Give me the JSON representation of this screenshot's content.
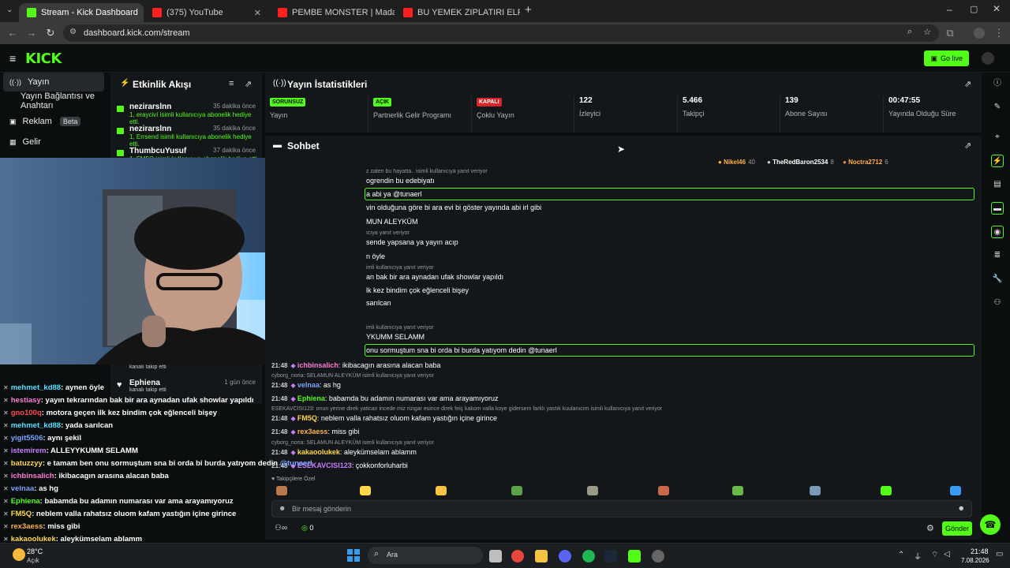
{
  "browser": {
    "tabs": [
      {
        "title": "Stream - Kick Dashboard",
        "fav": "#53fc18",
        "active": true
      },
      {
        "title": "(375) YouTube",
        "fav": "#ff2020",
        "active": false
      },
      {
        "title": "PEMBE MONSTER | Madara Ol",
        "fav": "#ff2020",
        "active": false
      },
      {
        "title": "BU YEMEK ZIPLATIRI ELRAEN, L",
        "fav": "#ff2020",
        "active": false
      }
    ],
    "url": "dashboard.kick.com/stream"
  },
  "header": {
    "logo": "KICK",
    "golive_label": "Go live"
  },
  "nav": {
    "items": [
      {
        "label": "Yayın",
        "icon": "broadcast-icon"
      },
      {
        "label": "Yayın Bağlantısı ve Anahtarı",
        "icon": ""
      },
      {
        "label": "Reklam",
        "icon": "ad-icon",
        "badge": "Beta"
      },
      {
        "label": "Gelir",
        "icon": "revenue-icon"
      }
    ]
  },
  "activity": {
    "title": "Etkinlik Akışı",
    "items": [
      {
        "name": "nezirarslnn",
        "time": "35 dakika önce",
        "detail": "1, erayciví isimli kullanıcıya abonelik hediye etti."
      },
      {
        "name": "nezirarslnn",
        "time": "35 dakika önce",
        "detail": "1, Errsend isimli kullanıcıya abonelik hediye etti."
      },
      {
        "name": "ThumbcuYusuf",
        "time": "37 dakika önce",
        "detail": "1, FM5Q isimli kullanıcıya abonelik hediye etti."
      }
    ],
    "lower": [
      {
        "detail": "kanalı takip etti"
      },
      {
        "name": "Ephiena",
        "time": "1 gün önce",
        "detail": "kanalı takip etti"
      }
    ]
  },
  "stats": {
    "title": "Yayın İstatistikleri",
    "cells": [
      {
        "badge": "SORUNSUZ",
        "label": "Yayın",
        "color": "#53fc18"
      },
      {
        "badge": "AÇIK",
        "label": "Partnerlik Gelir Programı",
        "color": "#53fc18"
      },
      {
        "badge": "KAPALI",
        "label": "Çoklu Yayın",
        "color": "#d8262c"
      },
      {
        "value": "122",
        "label": "İzleyici"
      },
      {
        "value": "5.466",
        "label": "Takipçi"
      },
      {
        "value": "139",
        "label": "Abone Sayısı"
      },
      {
        "value": "00:47:55",
        "label": "Yayında Olduğu Süre"
      }
    ]
  },
  "chat": {
    "title": "Sohbet",
    "top_users": [
      {
        "name": "Nikel46",
        "count": "40"
      },
      {
        "name": "TheRedBaron2534",
        "count": "8"
      },
      {
        "name": "Noctra2712",
        "count": "6"
      }
    ],
    "partial_lines": [
      "z zaten bu hayatta.. isimli kullanıcıya yanıt veriyor",
      "ogrendin bu edebiyatı",
      "a abi ya @tunaerl",
      "vin olduğuna göre bi ara evi bi göster yayında abi irl gibi",
      "MUN ALEYKÜM",
      "ıcıya yanıt veriyor",
      "sende yapsana ya yayın acıp",
      "n öyle",
      "imli kullanıcıya yanıt veriyor",
      "an bak bir ara aynadan ufak showlar yapıldı",
      "lk kez bindim çok eğlenceli bişey",
      "sarılcan",
      "imli kullanıcıya yanıt veriyor",
      "YKUMM SELAMM",
      "onu sormuştum sna bi orda bi burda yatıyom dedin @tunaerl"
    ],
    "messages": [
      {
        "time": "21:48",
        "user": "ichbinsalich",
        "color": "#ff7ad6",
        "text": "ikibacagın arasına alacan baba"
      },
      {
        "reply": "cyborg_noria: SELAMUN ALEYKÜM isimli kullanıcıya yanıt veriyor"
      },
      {
        "time": "21:48",
        "user": "velnaa",
        "color": "#7aa2ff",
        "text": "as hg"
      },
      {
        "time": "21:48",
        "user": "Ephiena",
        "color": "#53fc18",
        "text": "babamda bu adamın numarası var ama arayamıyoruz"
      },
      {
        "reply": "ESEKAVCISI123: onun yerine direk yatican incede miz rizigar esince direk feiç kakom valla koye gidersem farklı yastık kuulanıcım isimli kullanıcıya yanıt veriyor"
      },
      {
        "time": "21:48",
        "user": "FM5Q",
        "color": "#ffd84a",
        "text": "neblem valla rahatsız oluom kafam yastığın içine girince"
      },
      {
        "time": "21:48",
        "user": "rex3aess",
        "color": "#ffb14a",
        "text": "miss gibi"
      },
      {
        "reply": "cyborg_noria: SELAMUN ALEYKÜM isimli kullanıcıya yanıt veriyor"
      },
      {
        "time": "21:48",
        "user": "kakaoolukek",
        "color": "#ffd84a",
        "text": "aleykümselam ablamm"
      },
      {
        "time": "21:48",
        "user": "ESEKAVCISI123",
        "color": "#c87dff",
        "text": "çokkonforluharbi"
      }
    ],
    "emote_label": "Takipçilere Özel",
    "input_placeholder": "Bir mesaj gönderin",
    "send_label": "Gönder",
    "points": "0"
  },
  "overlay_chat": [
    {
      "user": "mehmet_kd88",
      "color": "#53e0ff",
      "text": ": aynen öyle"
    },
    {
      "user": "hestiasy",
      "color": "#ff7ad6",
      "text": ": yayın tekrarından bak bir ara aynadan ufak showlar yapıldı"
    },
    {
      "user": "gno100q",
      "color": "#ff4a4a",
      "text": ": motora geçen ilk kez bindim çok eğlenceli bişey"
    },
    {
      "user": "mehmet_kd88",
      "color": "#53e0ff",
      "text": ": yada sarılcan"
    },
    {
      "user": "yigit5506",
      "color": "#7aa2ff",
      "text": ": aynı şekil"
    },
    {
      "user": "istemirem",
      "color": "#c87dff",
      "text": ": ALLEYYKUMM SELAMM"
    },
    {
      "user": "batuzzyy",
      "color": "#ffd84a",
      "text": ": e tamam ben onu sormuştum sna bi orda bi burda yatıyom dedin ",
      "mention": "@tunaerl"
    },
    {
      "user": "ichbinsalich",
      "color": "#ff7ad6",
      "text": ": ikibacagın arasına alacan baba"
    },
    {
      "user": "velnaa",
      "color": "#7aa2ff",
      "text": ": as hg"
    },
    {
      "user": "Ephiena",
      "color": "#53fc18",
      "text": ": babamda bu adamın numarası var ama arayamıyoruz"
    },
    {
      "user": "FM5Q",
      "color": "#ffd84a",
      "text": ": neblem valla rahatsız oluom kafam yastığın içine girince"
    },
    {
      "user": "rex3aess",
      "color": "#ffb14a",
      "text": ": miss gibi"
    },
    {
      "user": "kakaoolukek",
      "color": "#ffd84a",
      "text": ": aleykümselam ablamm"
    },
    {
      "user": "ESEKAVCISI123",
      "color": "#c87dff",
      "text": ": çokkonforluharbi"
    }
  ],
  "taskbar": {
    "weather_temp": "28°C",
    "weather_label": "Açık",
    "search_label": "Ara",
    "time": "21:48",
    "date": "7.08.2026"
  }
}
